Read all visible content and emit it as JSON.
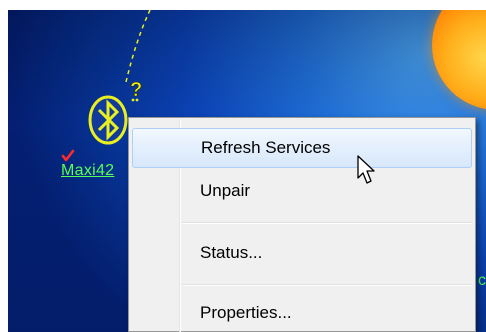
{
  "device": {
    "label": "Maxi42",
    "status_icon": "checkmark-icon",
    "device_icon": "bluetooth-icon",
    "unknown_icon": "question-mark-icon"
  },
  "partial_label": "c",
  "context_menu": {
    "items": [
      {
        "label": "Refresh Services",
        "highlighted": true
      },
      {
        "label": "Unpair",
        "highlighted": false
      },
      {
        "label": "Status...",
        "highlighted": false
      },
      {
        "label": "Properties...",
        "highlighted": false
      }
    ]
  },
  "colors": {
    "label": "#55ff55",
    "device_icon": "#e8f020",
    "menu_highlight_border": "#aecff7",
    "menu_background": "#f0f0f0"
  }
}
